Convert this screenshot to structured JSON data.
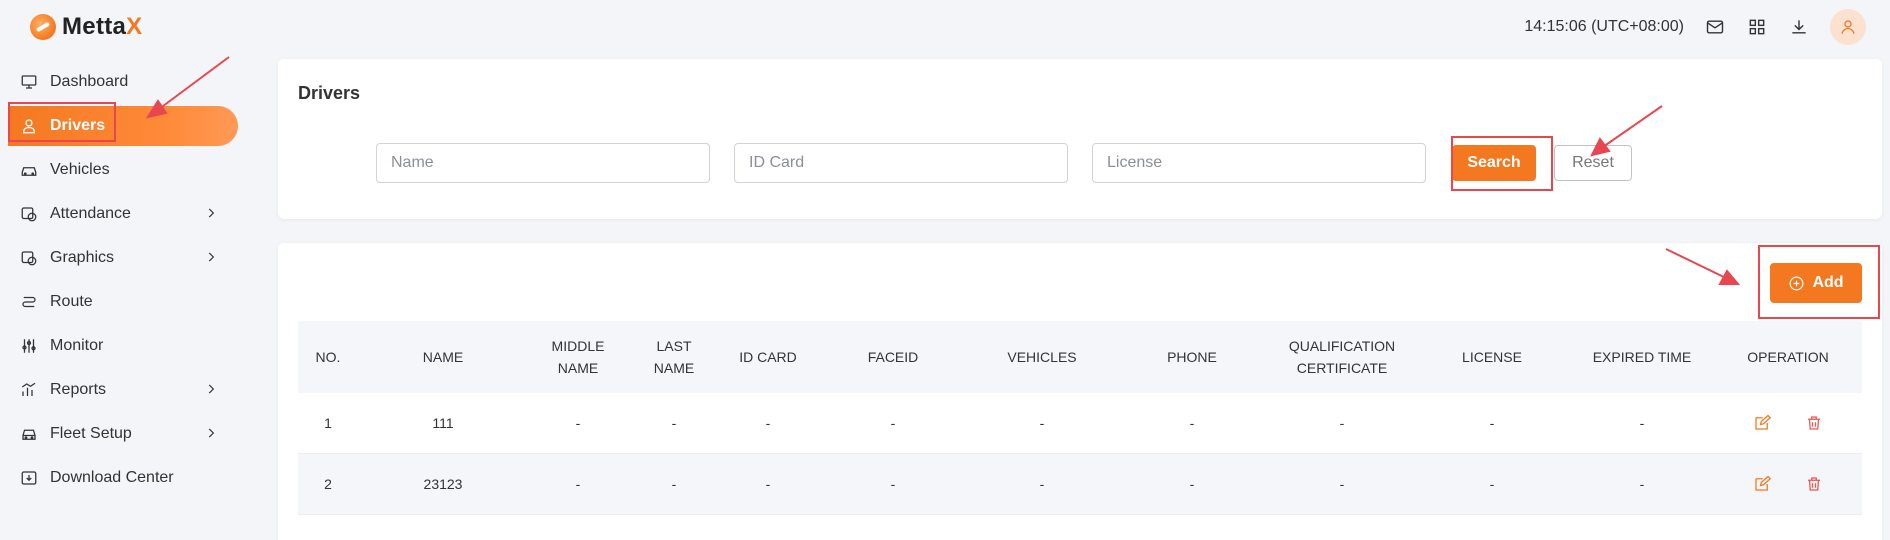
{
  "app": {
    "brand_prefix": "Metta",
    "brand_suffix": "X",
    "clock": "14:15:06 (UTC+08:00)"
  },
  "colors": {
    "accent": "#f47820",
    "annotation": "#e8474f",
    "delete": "#ef5350"
  },
  "sidebar": {
    "items": [
      {
        "label": "Dashboard",
        "icon": "monitor-icon"
      },
      {
        "label": "Drivers",
        "icon": "user-icon",
        "active": true
      },
      {
        "label": "Vehicles",
        "icon": "car-icon"
      },
      {
        "label": "Attendance",
        "icon": "clock-calendar-icon",
        "expandable": true
      },
      {
        "label": "Graphics",
        "icon": "chart-circle-icon",
        "expandable": true
      },
      {
        "label": "Route",
        "icon": "route-icon"
      },
      {
        "label": "Monitor",
        "icon": "sliders-icon"
      },
      {
        "label": "Reports",
        "icon": "bar-chart-icon",
        "expandable": true
      },
      {
        "label": "Fleet Setup",
        "icon": "vehicle-front-icon",
        "expandable": true
      },
      {
        "label": "Download Center",
        "icon": "download-box-icon"
      }
    ]
  },
  "search": {
    "title": "Drivers",
    "name_placeholder": "Name",
    "idcard_placeholder": "ID Card",
    "license_placeholder": "License",
    "search_label": "Search",
    "reset_label": "Reset"
  },
  "table": {
    "add_label": "Add",
    "headers": {
      "no": "NO.",
      "name": "NAME",
      "middle_1": "MIDDLE",
      "middle_2": "NAME",
      "last_1": "LAST",
      "last_2": "NAME",
      "idcard": "ID CARD",
      "faceid": "FACEID",
      "vehicles": "VEHICLES",
      "phone": "PHONE",
      "qual_1": "QUALIFICATION",
      "qual_2": "CERTIFICATE",
      "license": "LICENSE",
      "expired": "EXPIRED TIME",
      "operation": "OPERATION"
    },
    "rows": [
      {
        "no": "1",
        "name": "111",
        "middle": "-",
        "last": "-",
        "idcard": "-",
        "faceid": "-",
        "vehicles": "-",
        "phone": "-",
        "qual": "-",
        "license": "-",
        "expired": "-"
      },
      {
        "no": "2",
        "name": "23123",
        "middle": "-",
        "last": "-",
        "idcard": "-",
        "faceid": "-",
        "vehicles": "-",
        "phone": "-",
        "qual": "-",
        "license": "-",
        "expired": "-"
      }
    ]
  }
}
